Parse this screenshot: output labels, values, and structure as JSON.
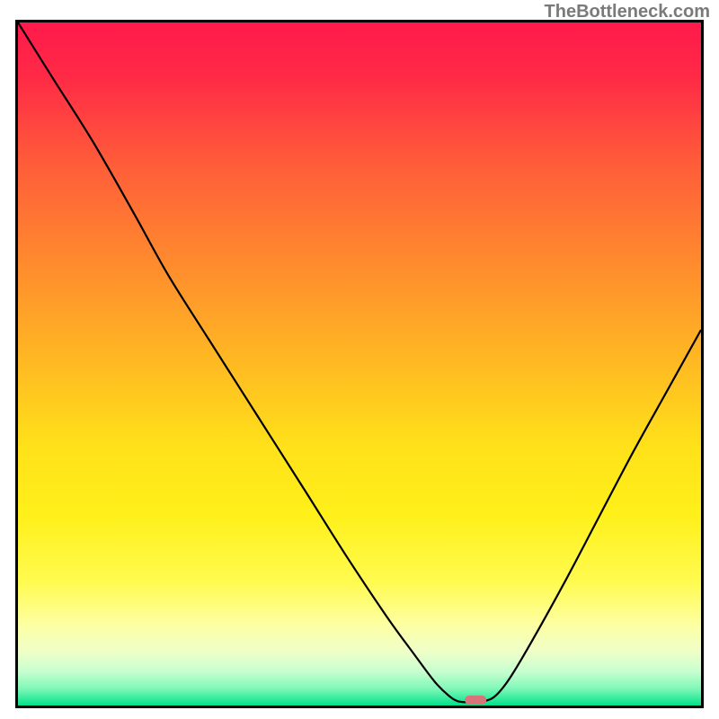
{
  "watermark": "TheBottleneck.com",
  "chart_data": {
    "type": "line",
    "title": "",
    "xlabel": "",
    "ylabel": "",
    "xlim": [
      0,
      100
    ],
    "ylim": [
      0,
      100
    ],
    "gradient_stops": [
      {
        "offset": 0.0,
        "color": "#ff1a4b"
      },
      {
        "offset": 0.08,
        "color": "#ff2a46"
      },
      {
        "offset": 0.2,
        "color": "#ff5a3a"
      },
      {
        "offset": 0.35,
        "color": "#ff8a2e"
      },
      {
        "offset": 0.5,
        "color": "#ffba22"
      },
      {
        "offset": 0.62,
        "color": "#ffe11a"
      },
      {
        "offset": 0.72,
        "color": "#fff01a"
      },
      {
        "offset": 0.82,
        "color": "#fffb50"
      },
      {
        "offset": 0.88,
        "color": "#fdffa0"
      },
      {
        "offset": 0.92,
        "color": "#f0ffc8"
      },
      {
        "offset": 0.95,
        "color": "#c8ffd0"
      },
      {
        "offset": 0.975,
        "color": "#80f8b8"
      },
      {
        "offset": 1.0,
        "color": "#00e28a"
      }
    ],
    "series": [
      {
        "name": "curve",
        "type": "line",
        "data": [
          {
            "x": 0.0,
            "y": 100.0
          },
          {
            "x": 5.0,
            "y": 92.0
          },
          {
            "x": 11.0,
            "y": 82.5
          },
          {
            "x": 17.0,
            "y": 72.0
          },
          {
            "x": 22.0,
            "y": 63.0
          },
          {
            "x": 28.0,
            "y": 53.5
          },
          {
            "x": 35.0,
            "y": 42.5
          },
          {
            "x": 42.0,
            "y": 31.5
          },
          {
            "x": 48.0,
            "y": 22.0
          },
          {
            "x": 54.0,
            "y": 13.0
          },
          {
            "x": 58.0,
            "y": 7.5
          },
          {
            "x": 61.0,
            "y": 3.5
          },
          {
            "x": 63.0,
            "y": 1.5
          },
          {
            "x": 64.5,
            "y": 0.6
          },
          {
            "x": 66.5,
            "y": 0.5
          },
          {
            "x": 68.5,
            "y": 0.7
          },
          {
            "x": 70.0,
            "y": 1.5
          },
          {
            "x": 72.0,
            "y": 4.0
          },
          {
            "x": 75.0,
            "y": 9.0
          },
          {
            "x": 80.0,
            "y": 18.0
          },
          {
            "x": 85.0,
            "y": 27.5
          },
          {
            "x": 90.0,
            "y": 37.0
          },
          {
            "x": 95.0,
            "y": 46.0
          },
          {
            "x": 100.0,
            "y": 55.0
          }
        ]
      },
      {
        "name": "marker",
        "type": "marker",
        "data": [
          {
            "x": 67.0,
            "y": 0.8
          }
        ],
        "color": "#d9737a"
      }
    ]
  }
}
